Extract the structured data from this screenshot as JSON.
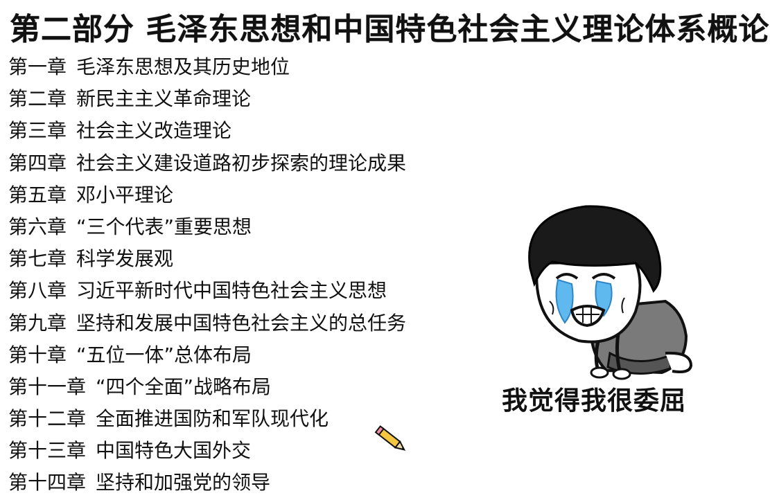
{
  "title": "第二部分 毛泽东思想和中国特色社会主义理论体系概论",
  "chapters": [
    {
      "num": "第一章",
      "name": "毛泽东思想及其历史地位"
    },
    {
      "num": "第二章",
      "name": "新民主主义革命理论"
    },
    {
      "num": "第三章",
      "name": "社会主义改造理论"
    },
    {
      "num": "第四章",
      "name": "社会主义建设道路初步探索的理论成果"
    },
    {
      "num": "第五章",
      "name": "邓小平理论"
    },
    {
      "num": "第六章",
      "name": "“三个代表”重要思想"
    },
    {
      "num": "第七章",
      "name": "科学发展观"
    },
    {
      "num": "第八章",
      "name": "习近平新时代中国特色社会主义思想"
    },
    {
      "num": "第九章",
      "name": "坚持和发展中国特色社会主义的总任务"
    },
    {
      "num": "第十章",
      "name": "“五位一体”总体布局"
    },
    {
      "num": "第十一章",
      "name": "“四个全面”战略布局"
    },
    {
      "num": "第十二章",
      "name": "全面推进国防和军队现代化"
    },
    {
      "num": "第十三章",
      "name": "中国特色大国外交"
    },
    {
      "num": "第十四章",
      "name": "坚持和加强党的领导"
    }
  ],
  "meme": {
    "caption": "我觉得我很委屈",
    "icon": "crying-bowl-cut-face"
  },
  "cursor": {
    "icon": "pencil-cursor-icon"
  }
}
